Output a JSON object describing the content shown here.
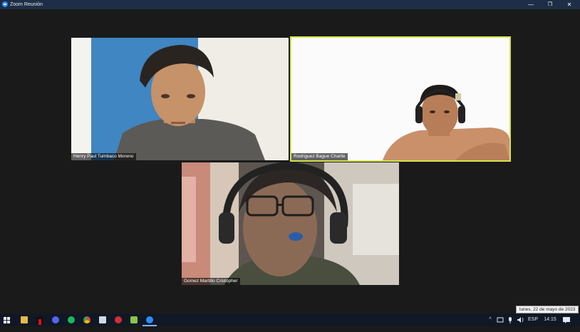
{
  "window": {
    "title": "Zoom Reunión",
    "minimize": "—",
    "maximize": "❐",
    "close": "✕"
  },
  "participants": [
    {
      "name": "Henry Paul Tumbaco Moreno",
      "active_speaker": false
    },
    {
      "name": "Rodriguez Bague Charlie",
      "active_speaker": true
    },
    {
      "name": "Gomez Martillo Cristopher",
      "active_speaker": false
    }
  ],
  "colors": {
    "titlebar": "#1e2e46",
    "background": "#1a1a1a",
    "active_speaker_border": "#d4e34c",
    "taskbar": "#101826",
    "zoom_blue": "#2d8cff"
  },
  "taskbar": {
    "pinned_icons": [
      "windows-start",
      "file-explorer",
      "netflix",
      "discord",
      "spotify",
      "chrome",
      "app",
      "record",
      "android",
      "zoom"
    ],
    "tray": {
      "chevron": "^",
      "language": "ESP",
      "time": "14:15"
    }
  },
  "tooltip": {
    "date": "lunes, 22 de mayo de 2023"
  }
}
